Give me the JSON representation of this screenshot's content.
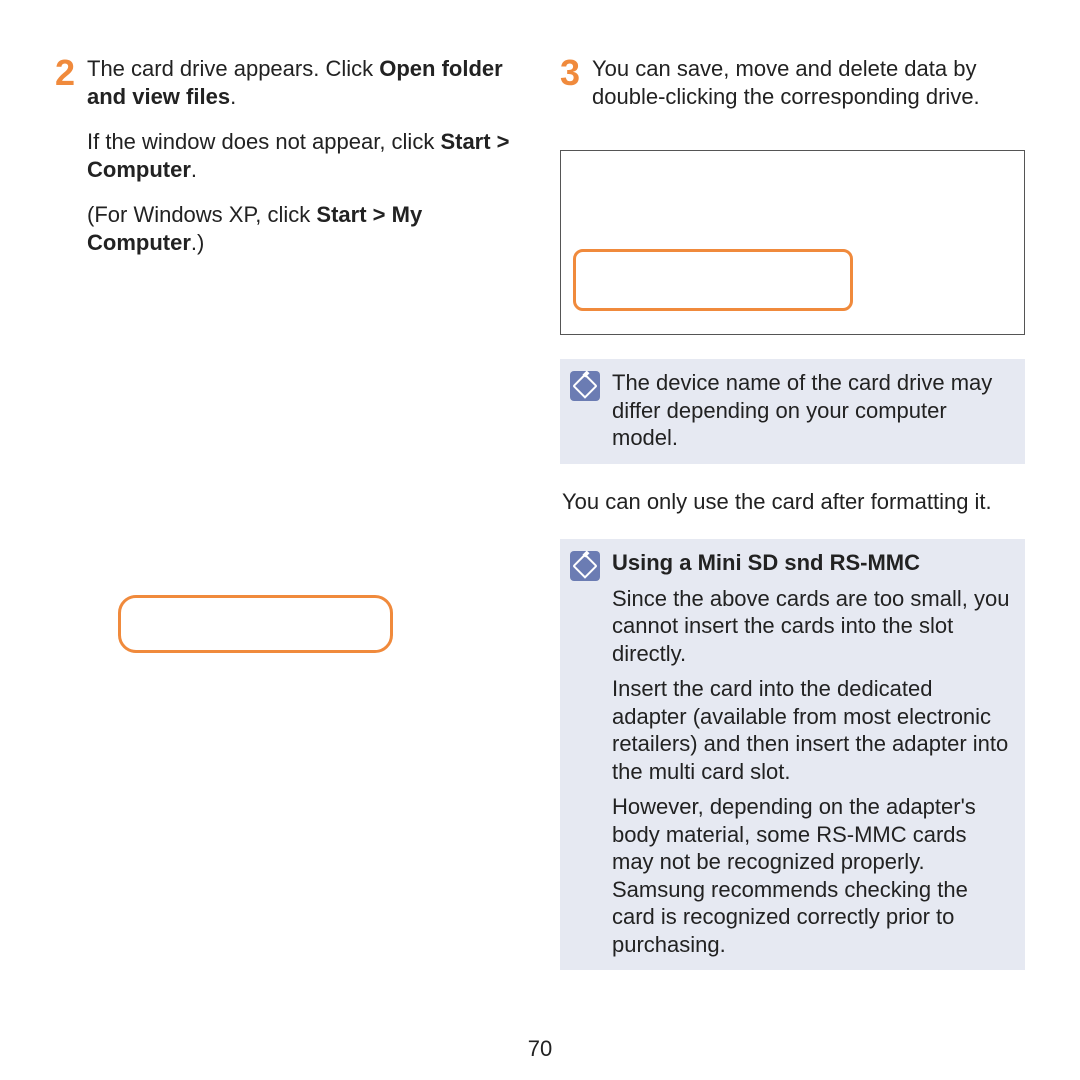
{
  "left": {
    "step_num": "2",
    "p1_pre": "The card drive appears. Click ",
    "p1_b1": "Open folder and view files",
    "p1_post": ".",
    "p2_pre": "If the window does not appear, click ",
    "p2_b1": "Start > Computer",
    "p2_post": ".",
    "p3_pre": "(For Windows XP, click ",
    "p3_b1": "Start > My Computer",
    "p3_post": ".)"
  },
  "right": {
    "step_num": "3",
    "p1": "You can save, move and delete data by double-clicking the corresponding drive.",
    "note1": "The device name of the card drive may differ depending on your computer model.",
    "plain": "You can only use the card after formatting it.",
    "note2_title": "Using a Mini SD snd RS-MMC",
    "note2_p1": "Since the above cards are too small, you cannot insert the cards into the slot directly.",
    "note2_p2": "Insert the card into the dedicated adapter (available from most electronic retailers) and then insert the adapter into the multi card slot.",
    "note2_p3": "However, depending on the adapter's body material, some RS-MMC cards may not be recognized properly. Samsung recommends checking the card is recognized correctly prior to purchasing."
  },
  "page_number": "70"
}
